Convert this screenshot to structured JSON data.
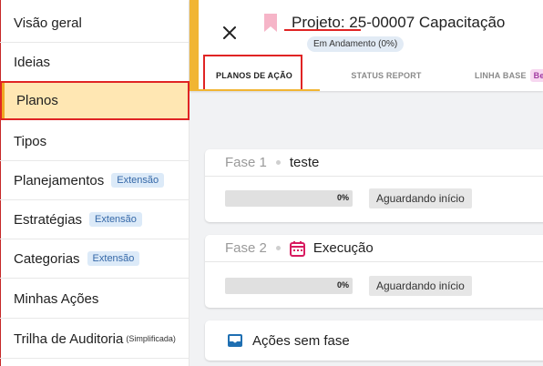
{
  "sidebar": {
    "items": [
      {
        "label": "Visão geral"
      },
      {
        "label": "Ideias"
      },
      {
        "label": "Planos"
      },
      {
        "label": "Tipos"
      },
      {
        "label": "Planejamentos",
        "badge": "Extensão"
      },
      {
        "label": "Estratégias",
        "badge": "Extensão"
      },
      {
        "label": "Categorias",
        "badge": "Extensão"
      },
      {
        "label": "Minhas Ações"
      },
      {
        "label": "Trilha de Auditoria",
        "suffix": "(Simplificada)"
      }
    ]
  },
  "header": {
    "title": "Projeto: 25-00007 Capacitação",
    "status": "Em Andamento (0%)",
    "close_icon": "close-icon",
    "bookmark_icon": "bookmark-icon",
    "tabs": [
      {
        "label": "PLANOS DE AÇÃO"
      },
      {
        "label": "STATUS REPORT"
      },
      {
        "label": "LINHA BASE",
        "badge": "Be"
      }
    ]
  },
  "phases": [
    {
      "label": "Fase 1",
      "name": "teste",
      "progress": 0,
      "progress_text": "0%",
      "status": "Aguardando início"
    },
    {
      "label": "Fase 2",
      "name": "Execução",
      "icon": "calendar-icon",
      "progress": 0,
      "progress_text": "0%",
      "status": "Aguardando início"
    }
  ],
  "no_phase": {
    "label": "Ações sem fase",
    "icon": "inbox-icon"
  },
  "colors": {
    "accent": "#f1b533",
    "highlight": "#e02424",
    "active_bg": "#ffe7b3"
  }
}
